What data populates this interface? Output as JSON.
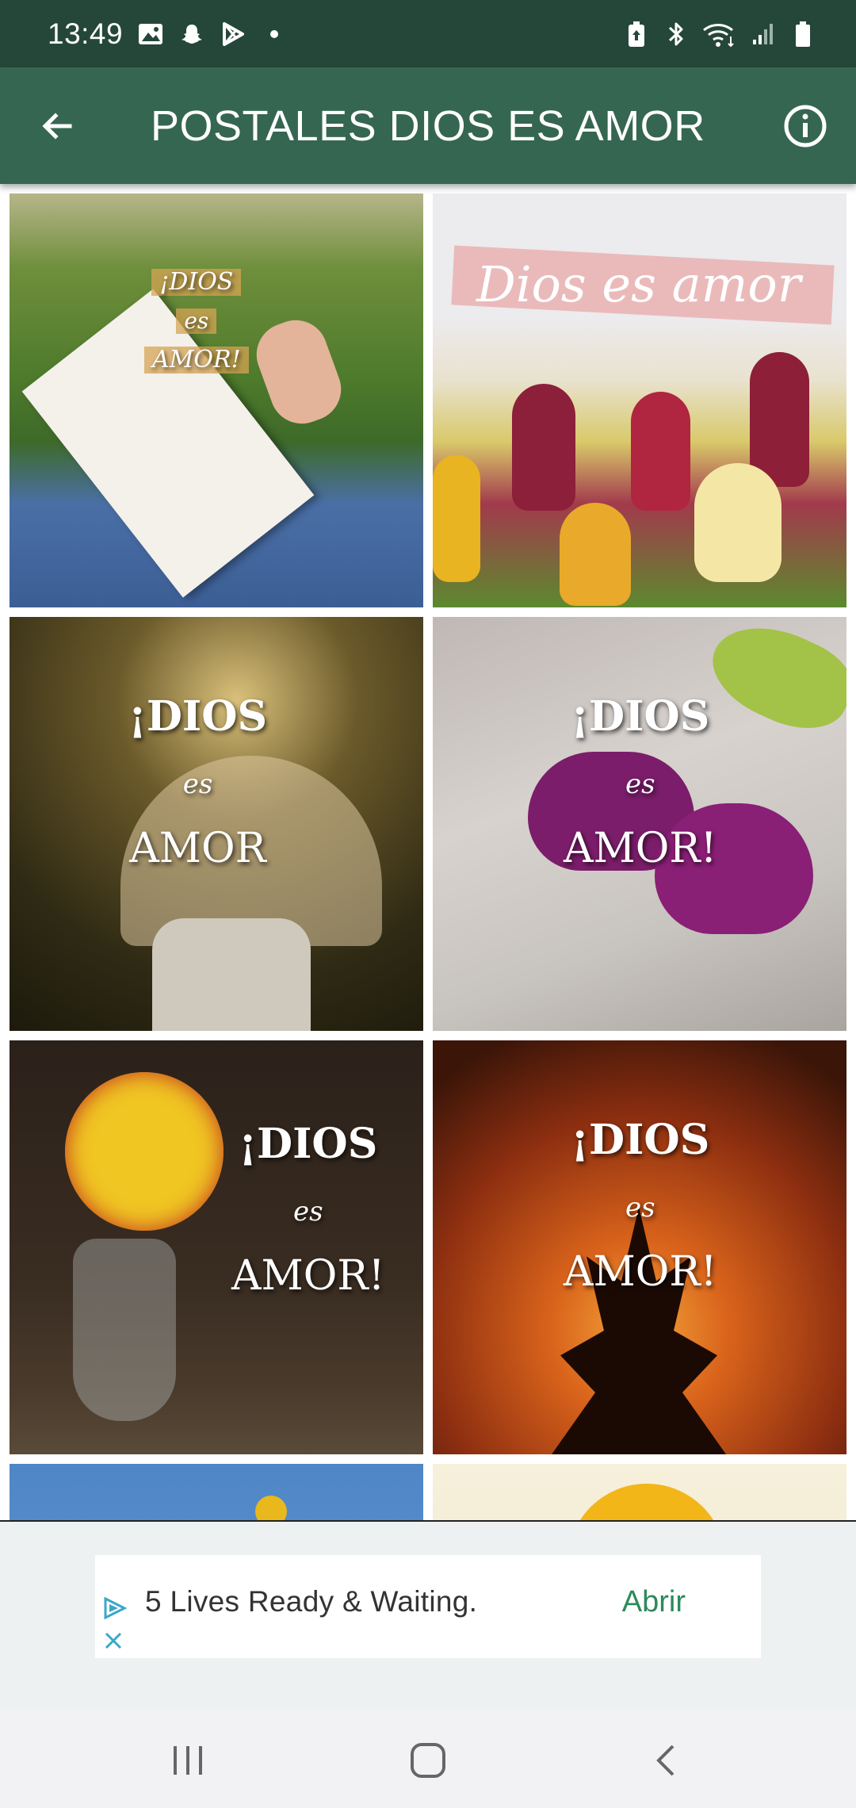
{
  "status_bar": {
    "time": "13:49",
    "icons_left": [
      "gallery-icon",
      "snapchat-icon",
      "play-store-icon",
      "dot-icon"
    ],
    "icons_right": [
      "battery-saver-icon",
      "bluetooth-icon",
      "wifi-icon",
      "signal-icon",
      "battery-icon"
    ]
  },
  "app_bar": {
    "title": "POSTALES DIOS ES AMOR",
    "back_icon": "arrow-back-icon",
    "info_icon": "info-icon",
    "bg_color": "#356652"
  },
  "gallery": {
    "items": [
      {
        "lines": [
          "¡DIOS",
          "es",
          "AMOR!"
        ]
      },
      {
        "lines": [
          "Dios es amor"
        ]
      },
      {
        "lines": [
          "¡DIOS",
          "es",
          "AMOR"
        ]
      },
      {
        "lines": [
          "¡DIOS",
          "es",
          "AMOR!"
        ]
      },
      {
        "lines": [
          "¡DIOS",
          "es",
          "AMOR!"
        ]
      },
      {
        "lines": [
          "¡DIOS",
          "es",
          "AMOR!"
        ]
      }
    ]
  },
  "ad": {
    "text": "5 Lives Ready & Waiting.",
    "cta": "Abrir",
    "cta_color": "#2b8a5b"
  },
  "nav_bar": {
    "buttons": [
      "recents-icon",
      "home-icon",
      "back-icon"
    ]
  }
}
